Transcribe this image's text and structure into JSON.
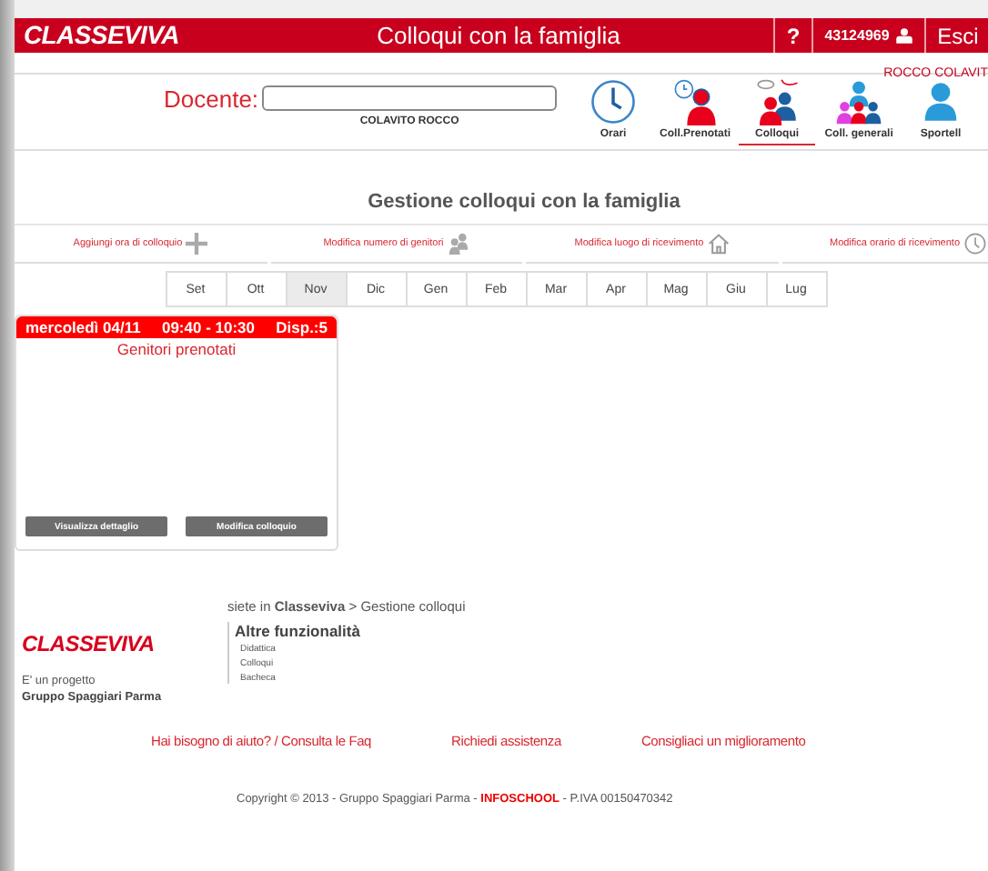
{
  "header": {
    "logo": "CLASSEVIVA",
    "title": "Colloqui con la famiglia",
    "help": "?",
    "user_code": "43124969",
    "logout": "Esci"
  },
  "user_name": "ROCCO COLAVIT",
  "toolbar": {
    "teacher_label": "Docente:",
    "teacher_value": "COLAVITO ROCCO",
    "nav": [
      {
        "kind": "clock",
        "label": "Orari",
        "selected": false
      },
      {
        "kind": "booked",
        "label": "Coll.Prenotati",
        "selected": false
      },
      {
        "kind": "talk",
        "label": "Colloqui",
        "selected": true
      },
      {
        "kind": "group",
        "label": "Coll. generali",
        "selected": false
      },
      {
        "kind": "person",
        "label": "Sportell",
        "selected": false
      }
    ]
  },
  "page_title": "Gestione colloqui con la famiglia",
  "actions": [
    {
      "kind": "plus",
      "label": "Aggiungi ora di colloquio"
    },
    {
      "kind": "people",
      "label": "Modifica numero di genitori"
    },
    {
      "kind": "house",
      "label": "Modifica luogo di ricevimento"
    },
    {
      "kind": "clock",
      "label": "Modifica orario di ricevimento"
    }
  ],
  "months": [
    {
      "label": "Set",
      "selected": false
    },
    {
      "label": "Ott",
      "selected": false
    },
    {
      "label": "Nov",
      "selected": true
    },
    {
      "label": "Dic",
      "selected": false
    },
    {
      "label": "Gen",
      "selected": false
    },
    {
      "label": "Feb",
      "selected": false
    },
    {
      "label": "Mar",
      "selected": false
    },
    {
      "label": "Apr",
      "selected": false
    },
    {
      "label": "Mag",
      "selected": false
    },
    {
      "label": "Giu",
      "selected": false
    },
    {
      "label": "Lug",
      "selected": false
    }
  ],
  "slots": [
    {
      "day": "mercoledì 04/11",
      "time": "09:40 - 10:30",
      "availability": "Disp.:5",
      "section": "Genitori prenotati",
      "buttons": [
        "Visualizza dettaglio",
        "Modifica colloquio"
      ]
    }
  ],
  "footer": {
    "logo": "CLASSEVIVA",
    "project": "E' un progetto",
    "company": "Gruppo Spaggiari Parma",
    "breadcrumb": "siete in **Classeviva** > Gestione colloqui",
    "more_title": "Altre funzionalità",
    "more_links": [
      "Didattica",
      "Colloqui",
      "Bacheca"
    ],
    "help_links": [
      "Hai bisogno di aiuto? / Consulta le Faq",
      "Richiedi assistenza",
      "Consigliaci un miglioramento"
    ],
    "copyright": "Copyright © 2013 - Gruppo Spaggiari Parma - **INFOSCHOOL** - P.IVA 00150470342"
  }
}
